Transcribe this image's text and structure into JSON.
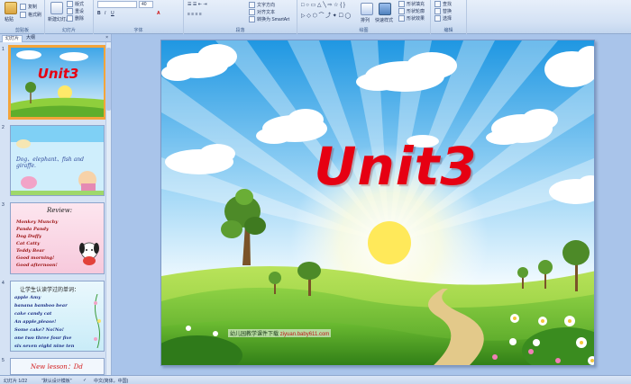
{
  "ribbon": {
    "clipboard": {
      "group_label": "剪贴板",
      "paste_label": "粘贴",
      "copy_label": "复制",
      "format_painter_label": "格式刷"
    },
    "slides": {
      "group_label": "幻灯片",
      "new_slide_label": "新建幻灯片",
      "layout_label": "版式",
      "reset_label": "重设",
      "delete_label": "删除"
    },
    "font": {
      "group_label": "字体",
      "font_size_value": "40"
    },
    "paragraph": {
      "group_label": "段落",
      "text_direction_label": "文字方向",
      "align_text_label": "对齐文本",
      "smartart_label": "转换为 SmartArt"
    },
    "drawing": {
      "group_label": "绘图",
      "arrange_label": "排列",
      "quick_styles_label": "快速样式",
      "shape_fill_label": "形状填充",
      "shape_outline_label": "形状轮廓",
      "shape_effects_label": "形状效果"
    },
    "editing": {
      "group_label": "编辑",
      "find_label": "查找",
      "replace_label": "替换",
      "select_label": "选择"
    }
  },
  "left_panel": {
    "tabs": [
      {
        "label": "幻灯片"
      },
      {
        "label": "大纲"
      }
    ],
    "thumbnails": [
      {
        "num": "1",
        "title": "Unit3"
      },
      {
        "num": "2",
        "caption": "Dog、elephant、fish and giraffe."
      },
      {
        "num": "3",
        "title": "Review:",
        "lines": [
          "Monkey Munchy",
          "Panda Pandy",
          "Dog Duffy",
          "Cat Catty",
          "Teddy Bear",
          "Good morning!",
          "Good afternoon!"
        ]
      },
      {
        "num": "4",
        "title": "让学生认读学过的单词：",
        "lines": [
          "apple Amy",
          "banana bamboo bear",
          "cake candy cat",
          "An apple,please!",
          "Some cake? No!No!",
          "one two three four five",
          "six seven eight nine ten"
        ]
      },
      {
        "num": "5",
        "title": "New lesson：Dd"
      }
    ]
  },
  "slide": {
    "title": "Unit3",
    "footer_text": "幼儿园教学课件下载",
    "footer_url": "ziyuan.baby611.com"
  },
  "status_bar": {
    "slide_count": "幻灯片 1/22",
    "theme": "\"默认设计模板\"",
    "language": "中文(简体，中国)"
  }
}
